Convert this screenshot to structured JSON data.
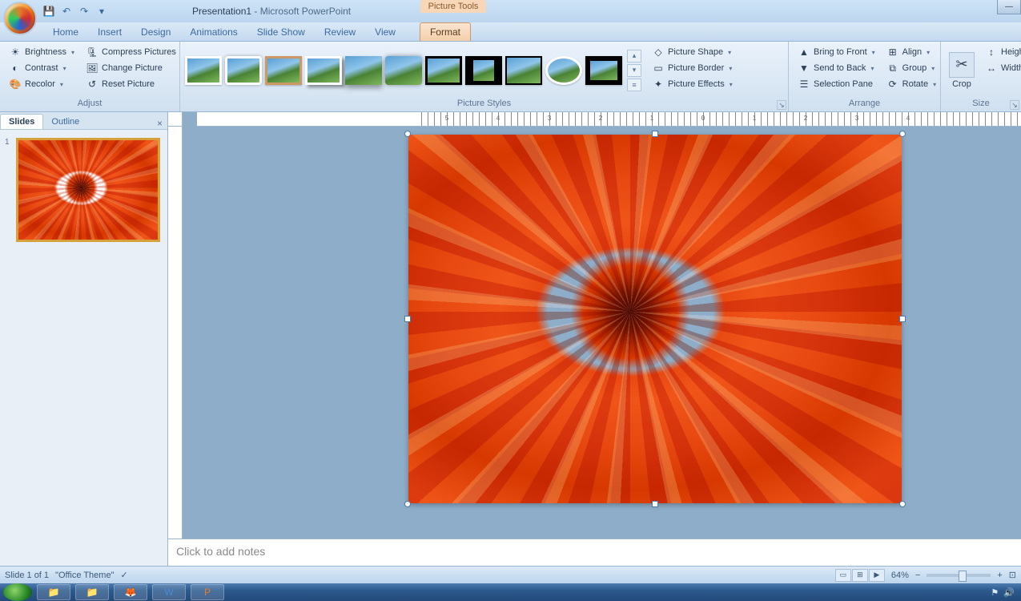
{
  "window": {
    "doc_title": "Presentation1",
    "app_title": "Microsoft PowerPoint",
    "context_tools": "Picture Tools"
  },
  "tabs": {
    "home": "Home",
    "insert": "Insert",
    "design": "Design",
    "animations": "Animations",
    "slideshow": "Slide Show",
    "review": "Review",
    "view": "View",
    "format": "Format"
  },
  "ribbon": {
    "adjust": {
      "brightness": "Brightness",
      "contrast": "Contrast",
      "recolor": "Recolor",
      "compress": "Compress Pictures",
      "change": "Change Picture",
      "reset": "Reset Picture",
      "label": "Adjust"
    },
    "styles": {
      "shape": "Picture Shape",
      "border": "Picture Border",
      "effects": "Picture Effects",
      "label": "Picture Styles"
    },
    "arrange": {
      "front": "Bring to Front",
      "back": "Send to Back",
      "pane": "Selection Pane",
      "align": "Align",
      "group": "Group",
      "rotate": "Rotate",
      "label": "Arrange"
    },
    "size": {
      "crop": "Crop",
      "height": "Height",
      "width": "Width:",
      "label": "Size"
    }
  },
  "slides_pane": {
    "tab_slides": "Slides",
    "tab_outline": "Outline",
    "slide_num": "1"
  },
  "notes": {
    "placeholder": "Click to add notes"
  },
  "status": {
    "slide": "Slide 1 of 1",
    "theme": "\"Office Theme\"",
    "zoom": "64%"
  },
  "ruler_marks": [
    "5",
    "4",
    "3",
    "2",
    "1",
    "0",
    "1",
    "2",
    "3",
    "4"
  ]
}
